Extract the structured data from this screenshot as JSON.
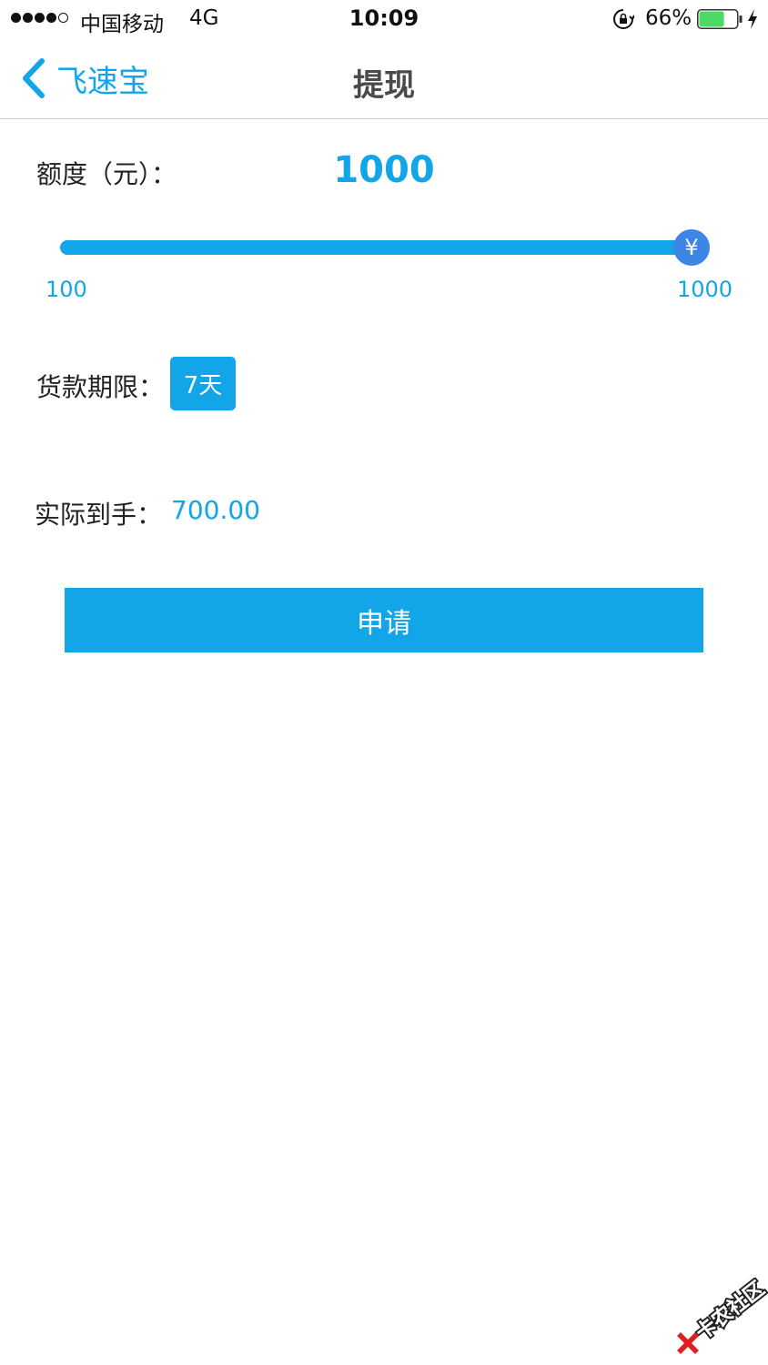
{
  "status_bar": {
    "carrier": "中国移动",
    "network": "4G",
    "time": "10:09",
    "battery_percent": "66%",
    "battery_level": 0.66,
    "battery_color": "#4cd964"
  },
  "nav": {
    "back_label": "飞速宝",
    "title": "提现"
  },
  "amount": {
    "label": "额度（元）：",
    "value": "1000"
  },
  "slider": {
    "min": "100",
    "max": "1000",
    "current": 1000,
    "handle_symbol": "¥"
  },
  "term": {
    "label": "货款期限：",
    "options": [
      "7天"
    ],
    "selected": "7天"
  },
  "actual": {
    "label": "实际到手：",
    "value": "700.00"
  },
  "apply_button": {
    "label": "申请"
  },
  "watermark": {
    "text": "卡农社区"
  },
  "colors": {
    "accent": "#12a6e8",
    "slider_handle": "#3d86e6",
    "nav_title": "#4a4a4a"
  }
}
